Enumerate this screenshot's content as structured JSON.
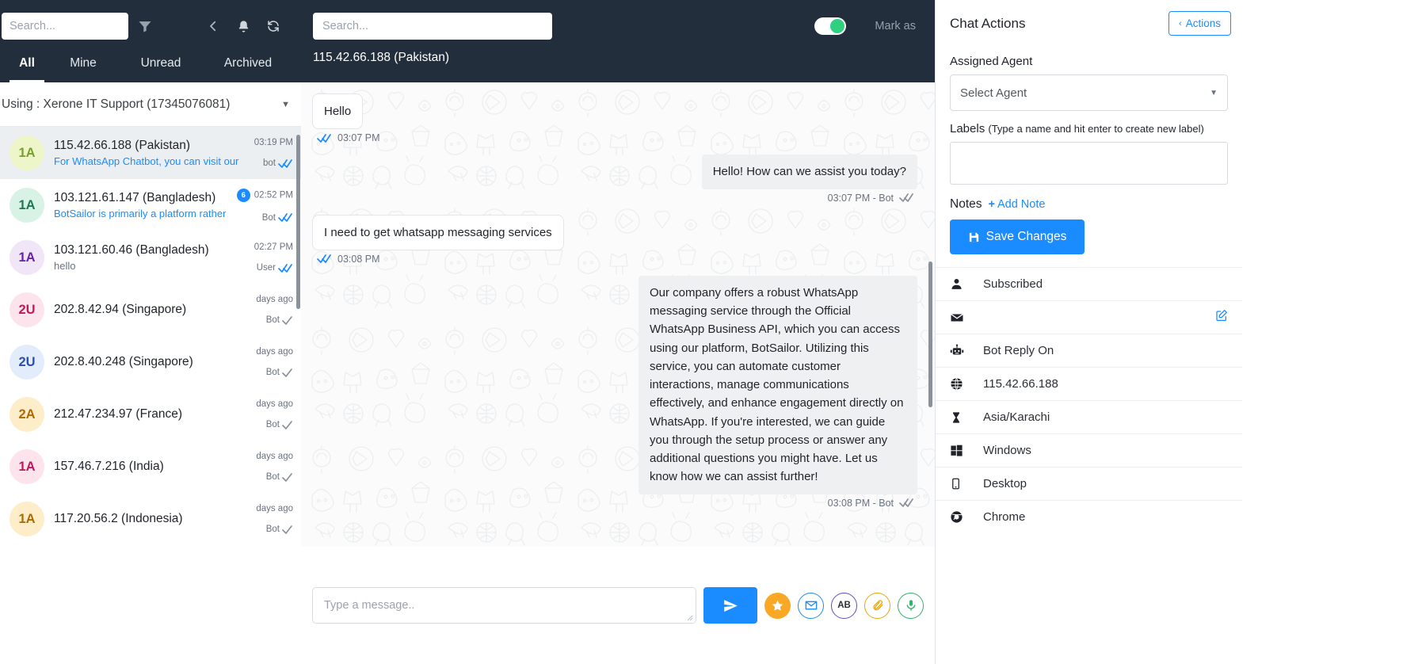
{
  "left": {
    "search": {
      "placeholder": "Search...",
      "value": ""
    },
    "icons": {
      "filter": "filter-icon",
      "collapse": "collapse-left-icon",
      "bell": "bell-icon",
      "refresh": "refresh-icon"
    },
    "tabs": [
      {
        "label": "All",
        "active": true
      },
      {
        "label": "Mine",
        "active": false
      },
      {
        "label": "Unread",
        "active": false
      },
      {
        "label": "Archived",
        "active": false
      }
    ],
    "using": {
      "label": "Using : Xerone IT Support (17345076081)"
    },
    "conversations": [
      {
        "initials": "1A",
        "avatar_bg": "#eef5c8",
        "avatar_fg": "#74a32a",
        "name": "115.42.66.188 (Pakistan)",
        "preview": "For WhatsApp Chatbot, you can visit our",
        "preview_style": "blue",
        "time": "03:19 PM",
        "sender": "bot",
        "ticks": "double-blue",
        "unread": "",
        "selected": true
      },
      {
        "initials": "1A",
        "avatar_bg": "#d9f2e6",
        "avatar_fg": "#1b7a52",
        "name": "103.121.61.147 (Bangladesh)",
        "preview": "BotSailor is primarily a platform rather",
        "preview_style": "blue",
        "time": "02:52 PM",
        "sender": "Bot",
        "ticks": "double-blue",
        "unread": "6",
        "selected": false
      },
      {
        "initials": "1A",
        "avatar_bg": "#f0e6f7",
        "avatar_fg": "#6b21a8",
        "name": "103.121.60.46 (Bangladesh)",
        "preview": "hello",
        "preview_style": "gray",
        "time": "02:27 PM",
        "sender": "User",
        "ticks": "double-blue",
        "unread": "",
        "selected": false
      },
      {
        "initials": "2U",
        "avatar_bg": "#fde4ec",
        "avatar_fg": "#c2185b",
        "name": "202.8.42.94 (Singapore)",
        "preview": "",
        "preview_style": "gray",
        "time": "days ago",
        "sender": "Bot",
        "ticks": "single-gray",
        "unread": "",
        "selected": false
      },
      {
        "initials": "2U",
        "avatar_bg": "#e3ecfb",
        "avatar_fg": "#2a4fb0",
        "name": "202.8.40.248 (Singapore)",
        "preview": "",
        "preview_style": "gray",
        "time": "days ago",
        "sender": "Bot",
        "ticks": "single-gray",
        "unread": "",
        "selected": false
      },
      {
        "initials": "2A",
        "avatar_bg": "#fdeec9",
        "avatar_fg": "#b06a00",
        "name": "212.47.234.97 (France)",
        "preview": "",
        "preview_style": "gray",
        "time": "days ago",
        "sender": "Bot",
        "ticks": "single-gray",
        "unread": "",
        "selected": false
      },
      {
        "initials": "1A",
        "avatar_bg": "#fde4ec",
        "avatar_fg": "#c2185b",
        "name": "157.46.7.216 (India)",
        "preview": "",
        "preview_style": "gray",
        "time": "days ago",
        "sender": "Bot",
        "ticks": "single-gray",
        "unread": "",
        "selected": false
      },
      {
        "initials": "1A",
        "avatar_bg": "#fdeec9",
        "avatar_fg": "#b06a00",
        "name": "117.20.56.2 (Indonesia)",
        "preview": "",
        "preview_style": "gray",
        "time": "days ago",
        "sender": "Bot",
        "ticks": "single-gray",
        "unread": "",
        "selected": false
      }
    ]
  },
  "center": {
    "search": {
      "placeholder": "Search...",
      "value": ""
    },
    "bot_toggle_on": true,
    "mark_as": "Mark as",
    "chat_title": "115.42.66.188 (Pakistan)",
    "messages": [
      {
        "dir": "in",
        "text": "Hello",
        "time": "03:07 PM",
        "sender": "",
        "ticks": "double-blue"
      },
      {
        "dir": "out",
        "text": "Hello! How can we assist you today?",
        "time": "03:07 PM",
        "sender": "Bot",
        "ticks": "double-gray"
      },
      {
        "dir": "in",
        "text": "I need to get whatsapp messaging services",
        "time": "03:08 PM",
        "sender": "",
        "ticks": "double-blue"
      },
      {
        "dir": "out",
        "text": "Our company offers a robust WhatsApp messaging service through the Official WhatsApp Business API, which you can access using our platform, BotSailor. Utilizing this service, you can automate customer interactions, manage communications effectively, and enhance engagement directly on WhatsApp. If you're interested, we can guide you through the setup process or answer any additional questions you might have. Let us know how we can assist further!",
        "time": "03:08 PM",
        "sender": "Bot",
        "ticks": "double-gray"
      }
    ],
    "composer": {
      "placeholder": "Type a message..",
      "value": "",
      "send": "send-icon",
      "buttons": [
        "star-icon",
        "email-template-icon",
        "ab-translate-icon",
        "attachment-icon",
        "microphone-icon"
      ]
    }
  },
  "right": {
    "title": "Chat Actions",
    "actions_button": "Actions",
    "assigned_agent_label": "Assigned Agent",
    "assigned_agent_value": "Select Agent",
    "labels_label": "Labels",
    "labels_hint": "(Type a name and hit enter to create new label)",
    "labels_value": "",
    "notes_label": "Notes",
    "add_note": "Add Note",
    "save_changes": "Save Changes",
    "info_rows": [
      {
        "icon": "user-icon",
        "text": "Subscribed",
        "edit": false
      },
      {
        "icon": "envelope-icon",
        "text": "",
        "edit": true
      },
      {
        "icon": "robot-icon",
        "text": "Bot Reply On",
        "edit": false
      },
      {
        "icon": "globe-icon",
        "text": "115.42.66.188",
        "edit": false
      },
      {
        "icon": "hourglass-icon",
        "text": "Asia/Karachi",
        "edit": false
      },
      {
        "icon": "windows-icon",
        "text": "Windows",
        "edit": false
      },
      {
        "icon": "mobile-icon",
        "text": "Desktop",
        "edit": false
      },
      {
        "icon": "chrome-icon",
        "text": "Chrome",
        "edit": false
      }
    ]
  },
  "colors": {
    "header_bg": "#232e3c",
    "accent_blue": "#1a8cff",
    "toggle_green": "#2fd07f",
    "selected_row": "#eceff1"
  }
}
